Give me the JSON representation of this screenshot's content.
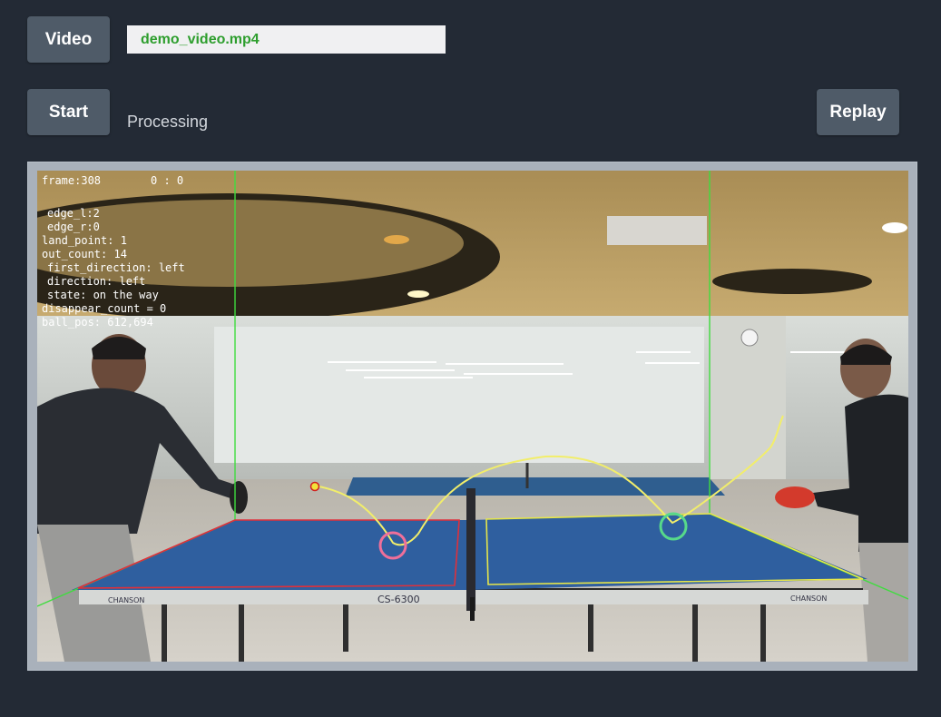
{
  "toolbar": {
    "video_label": "Video",
    "start_label": "Start",
    "replay_label": "Replay",
    "file_name": "demo_video.mp4",
    "status": "Processing"
  },
  "video_overlay": {
    "frame": "frame:308",
    "score": "0 : 0",
    "edge_l": "edge_l:2",
    "edge_r": "edge_r:0",
    "land_point": "land_point: 1",
    "out_count": "out_count: 14",
    "first_direction": "first_direction:  left",
    "direction": "direction: left",
    "state": "state: on the way",
    "disappear_count": "disappear_count = 0",
    "ball_pos": "ball_pos: 612,694"
  },
  "table_brand": {
    "model": "CS-6300",
    "brand_left": "CHANSON",
    "brand_right": "CHANSON"
  },
  "colors": {
    "background": "#232a35",
    "button": "#4f5b68",
    "filename_text": "#2e9e2e",
    "trajectory": "#f2ee6a",
    "edge_lines": "#3fdc3f",
    "left_half": "#e0303a",
    "right_half": "#e6e64a",
    "landing_marker_left": "#ef6f9a",
    "landing_marker_right": "#57d98a"
  }
}
